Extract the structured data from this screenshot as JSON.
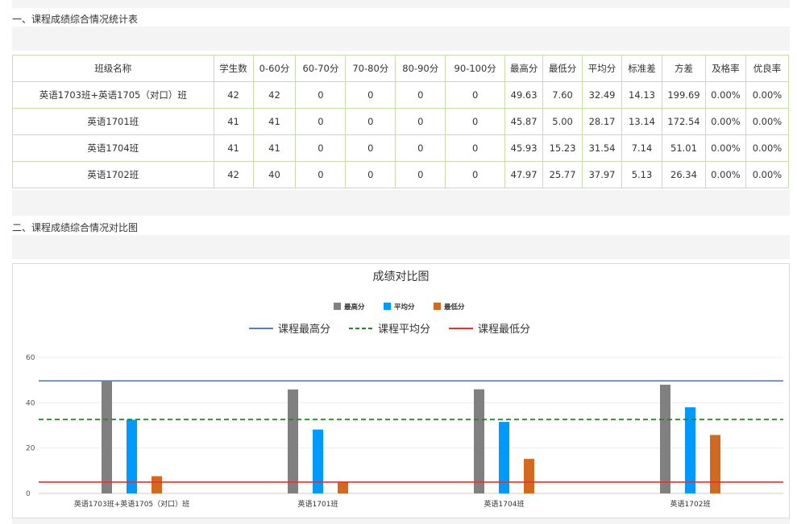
{
  "section1": {
    "title": "一、课程成绩综合情况统计表"
  },
  "section2": {
    "title": "二、课程成绩综合情况对比图"
  },
  "table": {
    "headers": [
      "班级名称",
      "学生数",
      "0-60分",
      "60-70分",
      "70-80分",
      "80-90分",
      "90-100分",
      "最高分",
      "最低分",
      "平均分",
      "标准差",
      "方差",
      "及格率",
      "优良率"
    ],
    "rows": [
      [
        "英语1703班+英语1705（对口）班",
        "42",
        "42",
        "0",
        "0",
        "0",
        "0",
        "49.63",
        "7.60",
        "32.49",
        "14.13",
        "199.69",
        "0.00%",
        "0.00%"
      ],
      [
        "英语1701班",
        "41",
        "41",
        "0",
        "0",
        "0",
        "0",
        "45.87",
        "5.00",
        "28.17",
        "13.14",
        "172.54",
        "0.00%",
        "0.00%"
      ],
      [
        "英语1704班",
        "41",
        "41",
        "0",
        "0",
        "0",
        "0",
        "45.93",
        "15.23",
        "31.54",
        "7.14",
        "51.01",
        "0.00%",
        "0.00%"
      ],
      [
        "英语1702班",
        "42",
        "40",
        "0",
        "0",
        "0",
        "0",
        "47.97",
        "25.77",
        "37.97",
        "5.13",
        "26.34",
        "0.00%",
        "0.00%"
      ]
    ]
  },
  "chart_data": {
    "type": "bar",
    "title": "成绩对比图",
    "categories": [
      "英语1703班+英语1705（对口）班",
      "英语1701班",
      "英语1704班",
      "英语1702班"
    ],
    "series": [
      {
        "name": "最高分",
        "values": [
          49.63,
          45.87,
          45.93,
          47.97
        ],
        "color": "#808080"
      },
      {
        "name": "平均分",
        "values": [
          32.49,
          28.17,
          31.54,
          37.97
        ],
        "color": "#0099ff"
      },
      {
        "name": "最低分",
        "values": [
          7.6,
          5.0,
          15.23,
          25.77
        ],
        "color": "#d2691e"
      }
    ],
    "reference_lines": [
      {
        "name": "课程最高分",
        "value": 49.63,
        "color": "#4f81bd",
        "style": "solid"
      },
      {
        "name": "课程平均分",
        "value": 32.6,
        "color": "#228b22",
        "style": "dashed"
      },
      {
        "name": "课程最低分",
        "value": 5.0,
        "color": "#e8302c",
        "style": "solid"
      }
    ],
    "yticks": [
      "0",
      "20",
      "40",
      "60"
    ],
    "ylim": [
      0,
      60
    ],
    "grid": true,
    "legend_position": "top-center"
  }
}
